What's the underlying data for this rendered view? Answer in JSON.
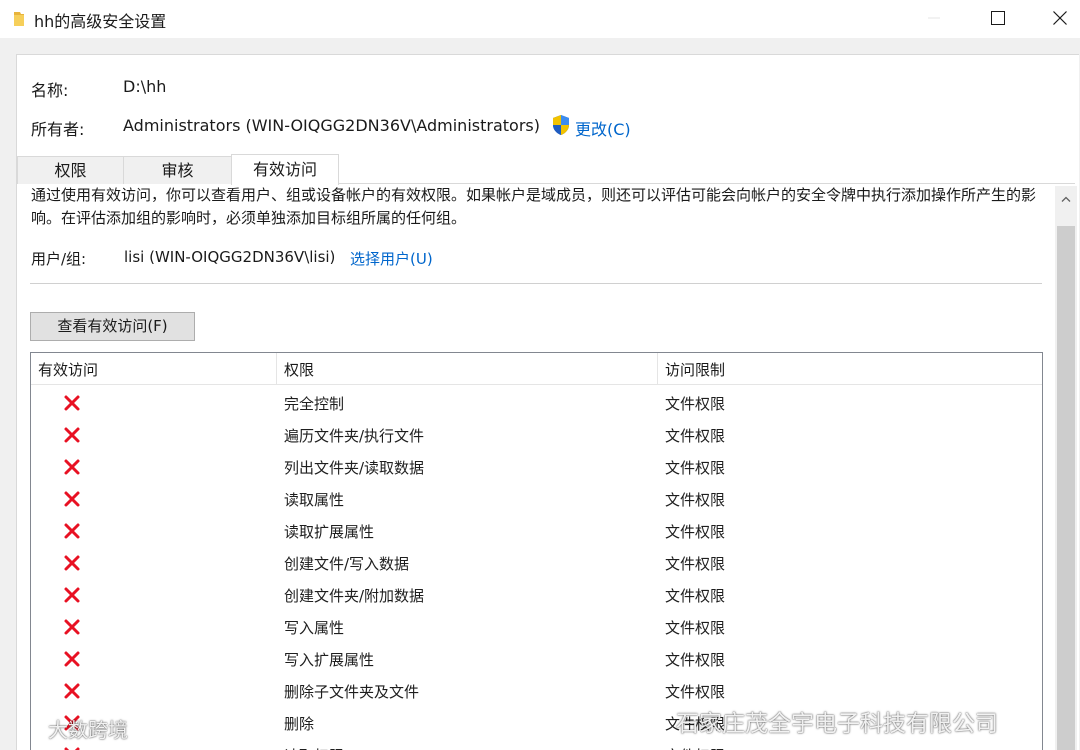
{
  "window": {
    "title": "hh的高级安全设置",
    "close_glyph": "✕",
    "max_glyph": "□"
  },
  "header": {
    "name_label": "名称:",
    "name_value": "D:\\hh",
    "owner_label": "所有者:",
    "owner_value": "Administrators (WIN-OIQGG2DN36V\\Administrators)",
    "change_link": "更改(C)"
  },
  "tabs": [
    {
      "label": "权限"
    },
    {
      "label": "审核"
    },
    {
      "label": "有效访问"
    }
  ],
  "panel": {
    "description": "通过使用有效访问，你可以查看用户、组或设备帐户的有效权限。如果帐户是域成员，则还可以评估可能会向帐户的安全令牌中执行添加操作所产生的影响。在评估添加组的影响时，必须单独添加目标组所属的任何组。",
    "user_label": "用户/组:",
    "user_value": "lisi (WIN-OIQGG2DN36V\\lisi)",
    "select_user_link": "选择用户(U)",
    "view_button": "查看有效访问(F)"
  },
  "table": {
    "columns": [
      "有效访问",
      "权限",
      "访问限制"
    ],
    "rows": [
      {
        "perm": "完全控制",
        "limit": "文件权限"
      },
      {
        "perm": "遍历文件夹/执行文件",
        "limit": "文件权限"
      },
      {
        "perm": "列出文件夹/读取数据",
        "limit": "文件权限"
      },
      {
        "perm": "读取属性",
        "limit": "文件权限"
      },
      {
        "perm": "读取扩展属性",
        "limit": "文件权限"
      },
      {
        "perm": "创建文件/写入数据",
        "limit": "文件权限"
      },
      {
        "perm": "创建文件夹/附加数据",
        "limit": "文件权限"
      },
      {
        "perm": "写入属性",
        "limit": "文件权限"
      },
      {
        "perm": "写入扩展属性",
        "limit": "文件权限"
      },
      {
        "perm": "删除子文件夹及文件",
        "limit": "文件权限"
      },
      {
        "perm": "删除",
        "limit": "文件权限"
      },
      {
        "perm": "读取权限",
        "limit": "文件权限"
      }
    ]
  },
  "watermarks": {
    "left": "大数跨境",
    "right": "石家庄茂全宇电子科技有限公司"
  },
  "colors": {
    "deny": "#e81123",
    "link": "#0066cc"
  },
  "icons": [
    "folder-icon",
    "minimize-icon",
    "maximize-icon",
    "close-icon",
    "uac-shield-icon",
    "deny-x-icon",
    "scroll-up-icon"
  ]
}
